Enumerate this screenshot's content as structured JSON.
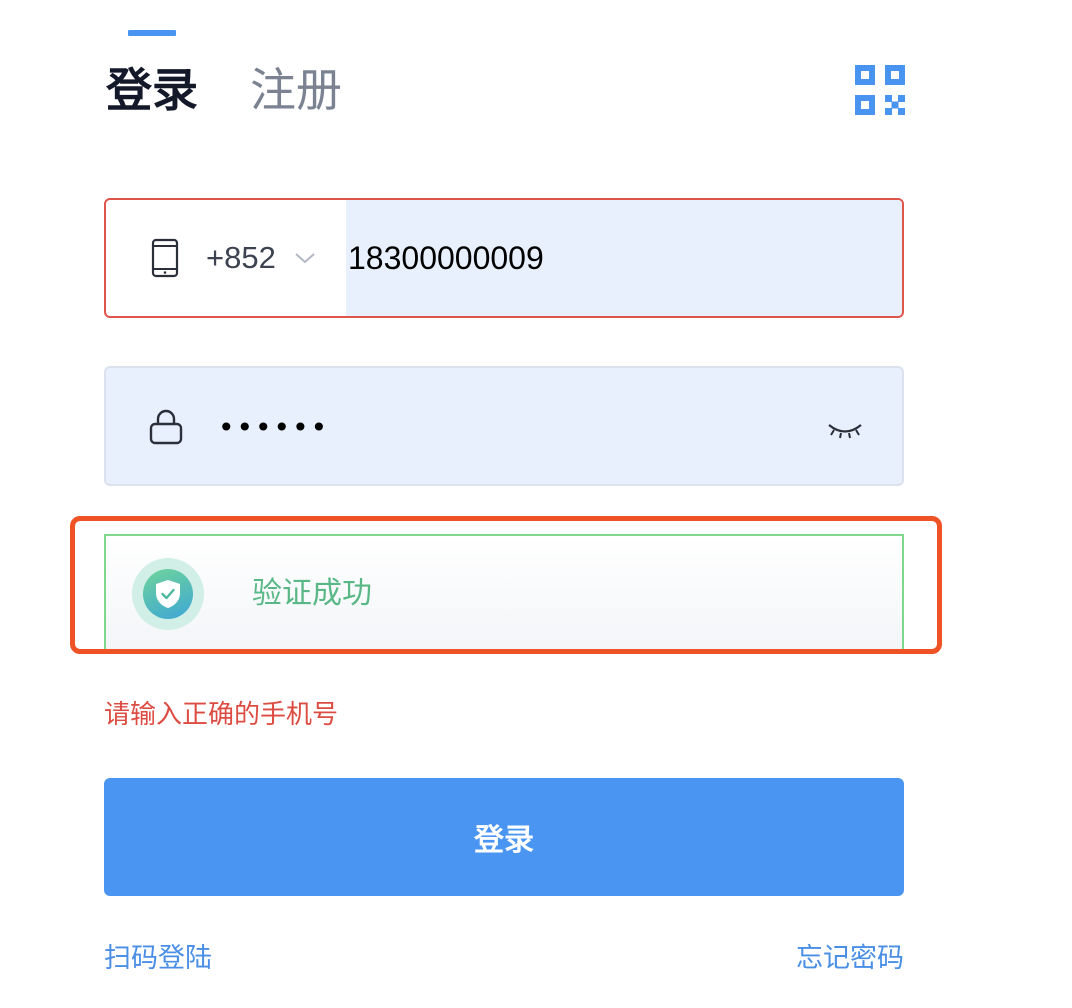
{
  "tabs": {
    "login": "登录",
    "register": "注册",
    "active": "login"
  },
  "icons": {
    "qr": "qr-code-icon",
    "phone": "mobile-phone-icon",
    "chevron": "chevron-down-icon",
    "lock": "lock-icon",
    "eye": "eye-closed-icon",
    "verified": "shield-check-icon"
  },
  "phone": {
    "country_code": "+852",
    "value": "18300000009"
  },
  "password": {
    "value": "••••••"
  },
  "verify": {
    "status_text": "验证成功"
  },
  "error": {
    "message": "请输入正确的手机号"
  },
  "submit": {
    "label": "登录"
  },
  "footer": {
    "scan_login": "扫码登陆",
    "forgot_password": "忘记密码"
  },
  "colors": {
    "accent": "#4a95f1",
    "error": "#dd4c42",
    "success": "#5ab886",
    "highlight": "#ee5225"
  }
}
